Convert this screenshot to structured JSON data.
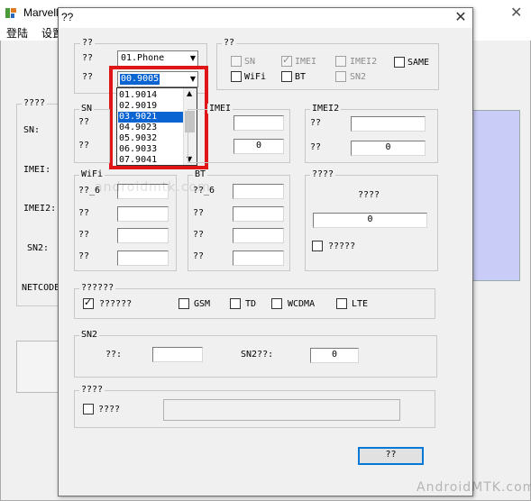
{
  "background_window": {
    "title": "Marvell",
    "menu": [
      "登陆",
      "设置"
    ],
    "group_title": "????",
    "labels": [
      "SN:",
      "IMEI:",
      "IMEI2:",
      "SN2:",
      "NETCODE"
    ]
  },
  "dialog": {
    "title": "??",
    "close_glyph": "✕",
    "mode_group": {
      "title": "??",
      "row1_label": "??",
      "row2_label": "??",
      "combo1_value": "01.Phone",
      "combo2_value": "00.9005",
      "dropdown_items": [
        "01.9014",
        "02.9019",
        "03.9021",
        "04.9023",
        "05.9032",
        "06.9033",
        "07.9041"
      ],
      "selected_index": 2
    },
    "options_group": {
      "title": "??",
      "checkboxes": [
        {
          "label": "SN",
          "checked": false,
          "disabled": true
        },
        {
          "label": "IMEI",
          "checked": true,
          "disabled": true
        },
        {
          "label": "IMEI2",
          "checked": false,
          "disabled": true
        },
        {
          "label": "SAME",
          "checked": false,
          "disabled": false
        },
        {
          "label": "WiFi",
          "checked": false,
          "disabled": false
        },
        {
          "label": "BT",
          "checked": false,
          "disabled": false
        },
        {
          "label": "SN2",
          "checked": false,
          "disabled": true
        }
      ]
    },
    "sn_group": {
      "title": "SN",
      "row1": "??",
      "row2": "??"
    },
    "imei_group": {
      "title": "IMEI",
      "count_value": "0"
    },
    "imei2_group": {
      "title": "IMEI2",
      "row1": "??",
      "row2": "??",
      "count_value": "0"
    },
    "wifi_group": {
      "title": "WiFi",
      "rows": [
        "??_6",
        "??",
        "??",
        "??"
      ]
    },
    "bt_group": {
      "title": "BT",
      "rows": [
        "??_6",
        "??",
        "??",
        "??"
      ]
    },
    "count_group": {
      "title": "????",
      "label": "????",
      "value": "0",
      "checkbox_label": "?????"
    },
    "network_group": {
      "title": "??????",
      "checkboxes": [
        {
          "label": "??????",
          "checked": true
        },
        {
          "label": "GSM",
          "checked": false
        },
        {
          "label": "TD",
          "checked": false
        },
        {
          "label": "WCDMA",
          "checked": false
        },
        {
          "label": "LTE",
          "checked": false
        }
      ]
    },
    "sn2_group": {
      "title": "SN2",
      "label1": "??:",
      "label2": "SN2??:",
      "count_value": "0"
    },
    "bottom_group": {
      "title": "????",
      "checkbox_label": "????"
    },
    "ok_button": "??"
  },
  "watermarks": [
    "androidmtk.com",
    "AndroidMTK.com"
  ],
  "colors": {
    "highlight": "#e01515",
    "selection": "#0a64d2",
    "blue_panel": "#c9ccf7"
  }
}
